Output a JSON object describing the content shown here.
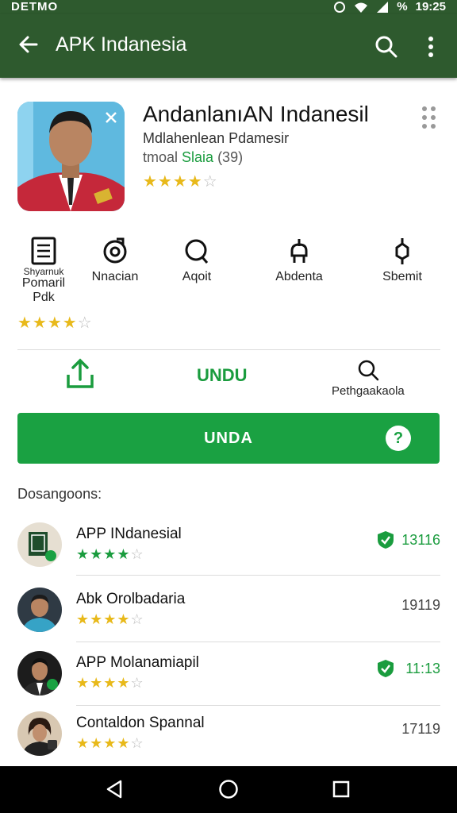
{
  "status": {
    "carrier": "DETMO",
    "battery": "%",
    "time": "19:25"
  },
  "appbar": {
    "title": "APK Indanesia"
  },
  "app": {
    "title": "AndanlanıAN Indanesil",
    "subtitle": "Mdlahenlean Pdamesir",
    "meta_prefix": "tmoal ",
    "meta_green": "Slaia",
    "meta_suffix": " (39)",
    "rating": 4
  },
  "categories": [
    {
      "name": "document-icon",
      "label_top": "Shyarnuk",
      "label": "Pomaril",
      "label_bottom": "Pdk"
    },
    {
      "name": "settings-icon",
      "label": "Nnacian"
    },
    {
      "name": "chat-icon",
      "label": "Aqoit"
    },
    {
      "name": "tool-icon",
      "label": "Abdenta"
    },
    {
      "name": "pin-icon",
      "label": "Sbemit"
    }
  ],
  "category_rating": 4,
  "actions": {
    "install_label": "UNDU",
    "search_label": "Pethgaakaola"
  },
  "main_button": {
    "label": "UNDA",
    "help": "?"
  },
  "section_title": "Dosangoons:",
  "list": [
    {
      "name": "APP INdanesial",
      "rating": 4,
      "time": "13116",
      "verified": true
    },
    {
      "name": "Abk Orolbadaria",
      "rating": 4,
      "time": "19119",
      "verified": false
    },
    {
      "name": "APP Molanamiapil",
      "rating": 4,
      "time": "11:13",
      "verified": true
    },
    {
      "name": "Contaldon Spannal",
      "rating": 4,
      "time": "17119",
      "verified": false
    }
  ],
  "colors": {
    "appbar": "#2e5a2e",
    "accent": "#1aa142",
    "star": "#e8b91a"
  }
}
